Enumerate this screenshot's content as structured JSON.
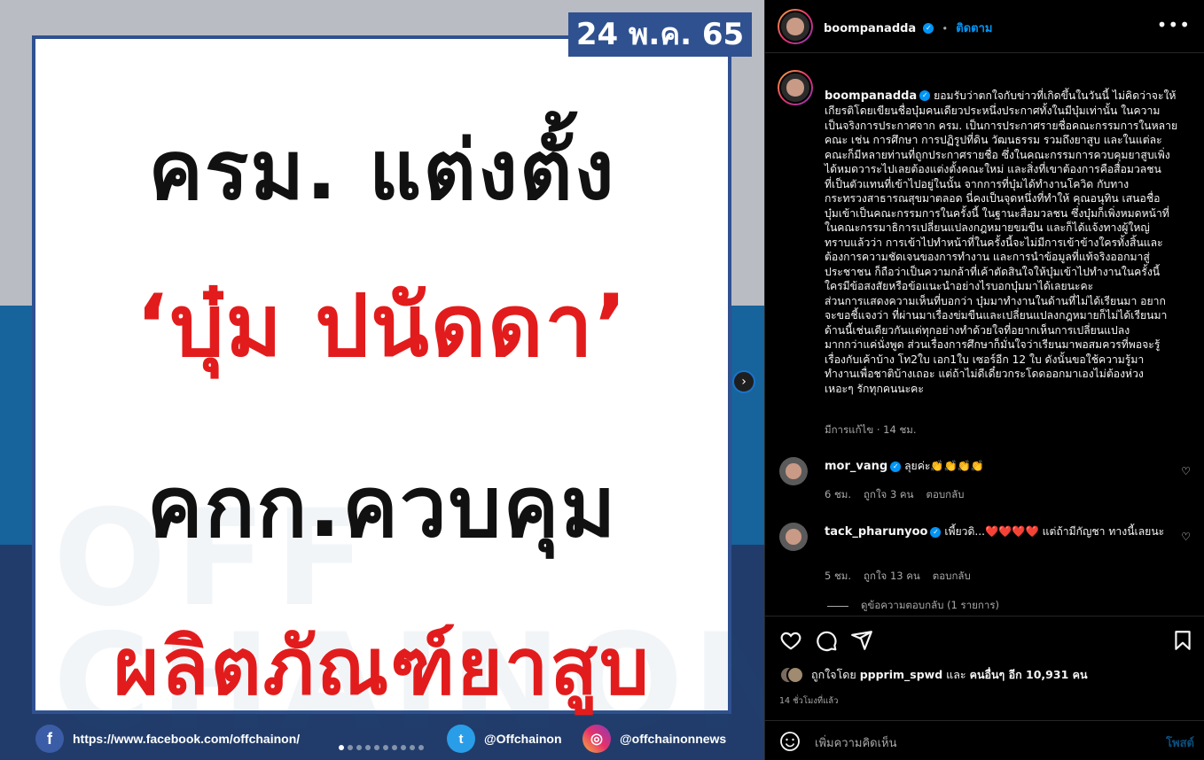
{
  "media": {
    "date_badge": "24 พ.ค. 65",
    "headline_1": "ครม. แต่งตั้ง",
    "headline_2": "‘บุ๋ม ปนัดดา’",
    "headline_3": "คกก.ควบคุม",
    "headline_4": "ผลิตภัณฑ์ยาสูบ",
    "watermark_1": "OFF",
    "watermark_2": "CHAINON",
    "facebook_url": "https://www.facebook.com/offchainon/",
    "twitter_handle": "@Offchainon",
    "instagram_handle": "@offchainonnews",
    "facebook_icon": "f",
    "twitter_icon": "t",
    "instagram_icon": "◎",
    "carousel_dot_count": 10,
    "carousel_active_index": 0,
    "colors": {
      "headline_red": "#e21c1c",
      "badge_blue": "#2f5190"
    }
  },
  "header": {
    "username": "boompanadda",
    "separator": "•",
    "follow_label": "ติดตาม",
    "more_label": "•••"
  },
  "caption": {
    "username": "boompanadda",
    "text": "ยอมรับว่าตกใจกับข่าวที่เกิดขึ้นในวันนี้ ไม่คิดว่าจะให้\nเกียรติโดยเขียนชื่อบุ๋มคนเดียวประหนึ่งประกาศทั้งในมีบุ๋มเท่านั้น ในความ\nเป็นจริงการประกาศจาก ครม. เป็นการประกาศรายชื่อคณะกรรมการในหลาย\nคณะ เช่น การศึกษา การปฏิรูปที่ดิน วัฒนธรรม รวมถึงยาสูบ และในแต่ละ\nคณะก็มีหลายท่านที่ถูกประกาศรายชื่อ ซึ่งในคณะกรรมการควบคุมยาสูบเพิ่ง\nได้หมดวาระไปเลยต้องแต่งตั้งคณะใหม่ และสิ่งที่เขาต้องการคือสื่อมวลชน\nที่เป็นตัวแทนที่เข้าไปอยู่ในนั้น จากการที่บุ๋มได้ทำงานโควิด กับทาง\nกระทรวงสาธารณสุขมาตลอด นี่คงเป็นจุดหนึ่งที่ทำให้ คุณอนุทิน เสนอชื่อ\nบุ๋มเข้าเป็นคณะกรรมการในครั้งนี้ ในฐานะสื่อมวลชน ซึ่งบุ๋มก็เพิ่งหมดหน้าที่\nในคณะกรรมาธิการเปลี่ยนแปลงกฎหมายขมขืน และก็ได้แจ้งทางผู้ใหญ่\nทราบแล้วว่า การเข้าไปทำหน้าที่ในครั้งนี้จะไม่มีการเข้าข้างใครทั้งสิ้นและ\nต้องการความชัดเจนของการทำงาน และการนำข้อมูลที่แท้จริงออกมาสู่\nประชาชน ก็ถือว่าเป็นความกล้าที่เค้าตัดสินใจให้บุ๋มเข้าไปทำงานในครั้งนี้\nใครมีข้อสงสัยหรือข้อแนะนำอย่างไรบอกบุ๋มมาได้เลยนะคะ\nส่วนการแสดงความเห็นที่บอกว่า บุ๋มมาทำงานในด้านที่ไม่ได้เรียนมา อยาก\nจะขอชี้แจงว่า ที่ผ่านมาเรื่องข่มขืนและเปลี่ยนแปลงกฎหมายก็ไม่ได้เรียนมา\nด้านนี้เช่นเดียวกันแต่ทุกอย่างทำด้วยใจที่อยากเห็นการเปลี่ยนแปลง\nมากกว่าแค่นั่งพูด ส่วนเรื่องการศึกษาก็มั่นใจว่าเรียนมาพอสมควรที่พอจะรู้\nเรื่องกับเค้าบ้าง โท2ใบ เอก1ใบ เซอร์อีก 12 ใบ ดังนั้นขอใช้ความรู้มา\nทำงานเพื่อชาติบ้างเถอะ แต่ถ้าไม่ดีเดี๋ยวกระโดดออกมาเองไม่ต้องห่วง\nเหอะๆ รักทุกคนนะคะ",
    "meta": "มีการแก้ไข · 14 ชม."
  },
  "comments": [
    {
      "username": "mor_vang",
      "text": "ลุยค่ะ👏👏👏👏",
      "time": "6 ชม.",
      "likes": "ถูกใจ 3 คน",
      "reply_label": "ตอบกลับ"
    },
    {
      "username": "tack_pharunyoo",
      "text": "เพี้ยวดิ...❤️❤️❤️❤️ แต่ถ้ามีกัญชา ทางนี้เลยนะ",
      "time": "5 ชม.",
      "likes": "ถูกใจ 13 คน",
      "reply_label": "ตอบกลับ"
    }
  ],
  "view_replies": "ดูข้อความตอบกลับ (1 รายการ)",
  "actions": {
    "liked_by_prefix": "ถูกใจโดย",
    "liked_by_user": "ppprim_spwd",
    "liked_by_mid": "และ",
    "liked_by_others": "คนอื่นๆ อีก 10,931 คน",
    "time_ago": "14 ชั่วโมงที่แล้ว"
  },
  "add_comment": {
    "placeholder": "เพิ่มความคิดเห็น",
    "post_label": "โพสต์"
  }
}
